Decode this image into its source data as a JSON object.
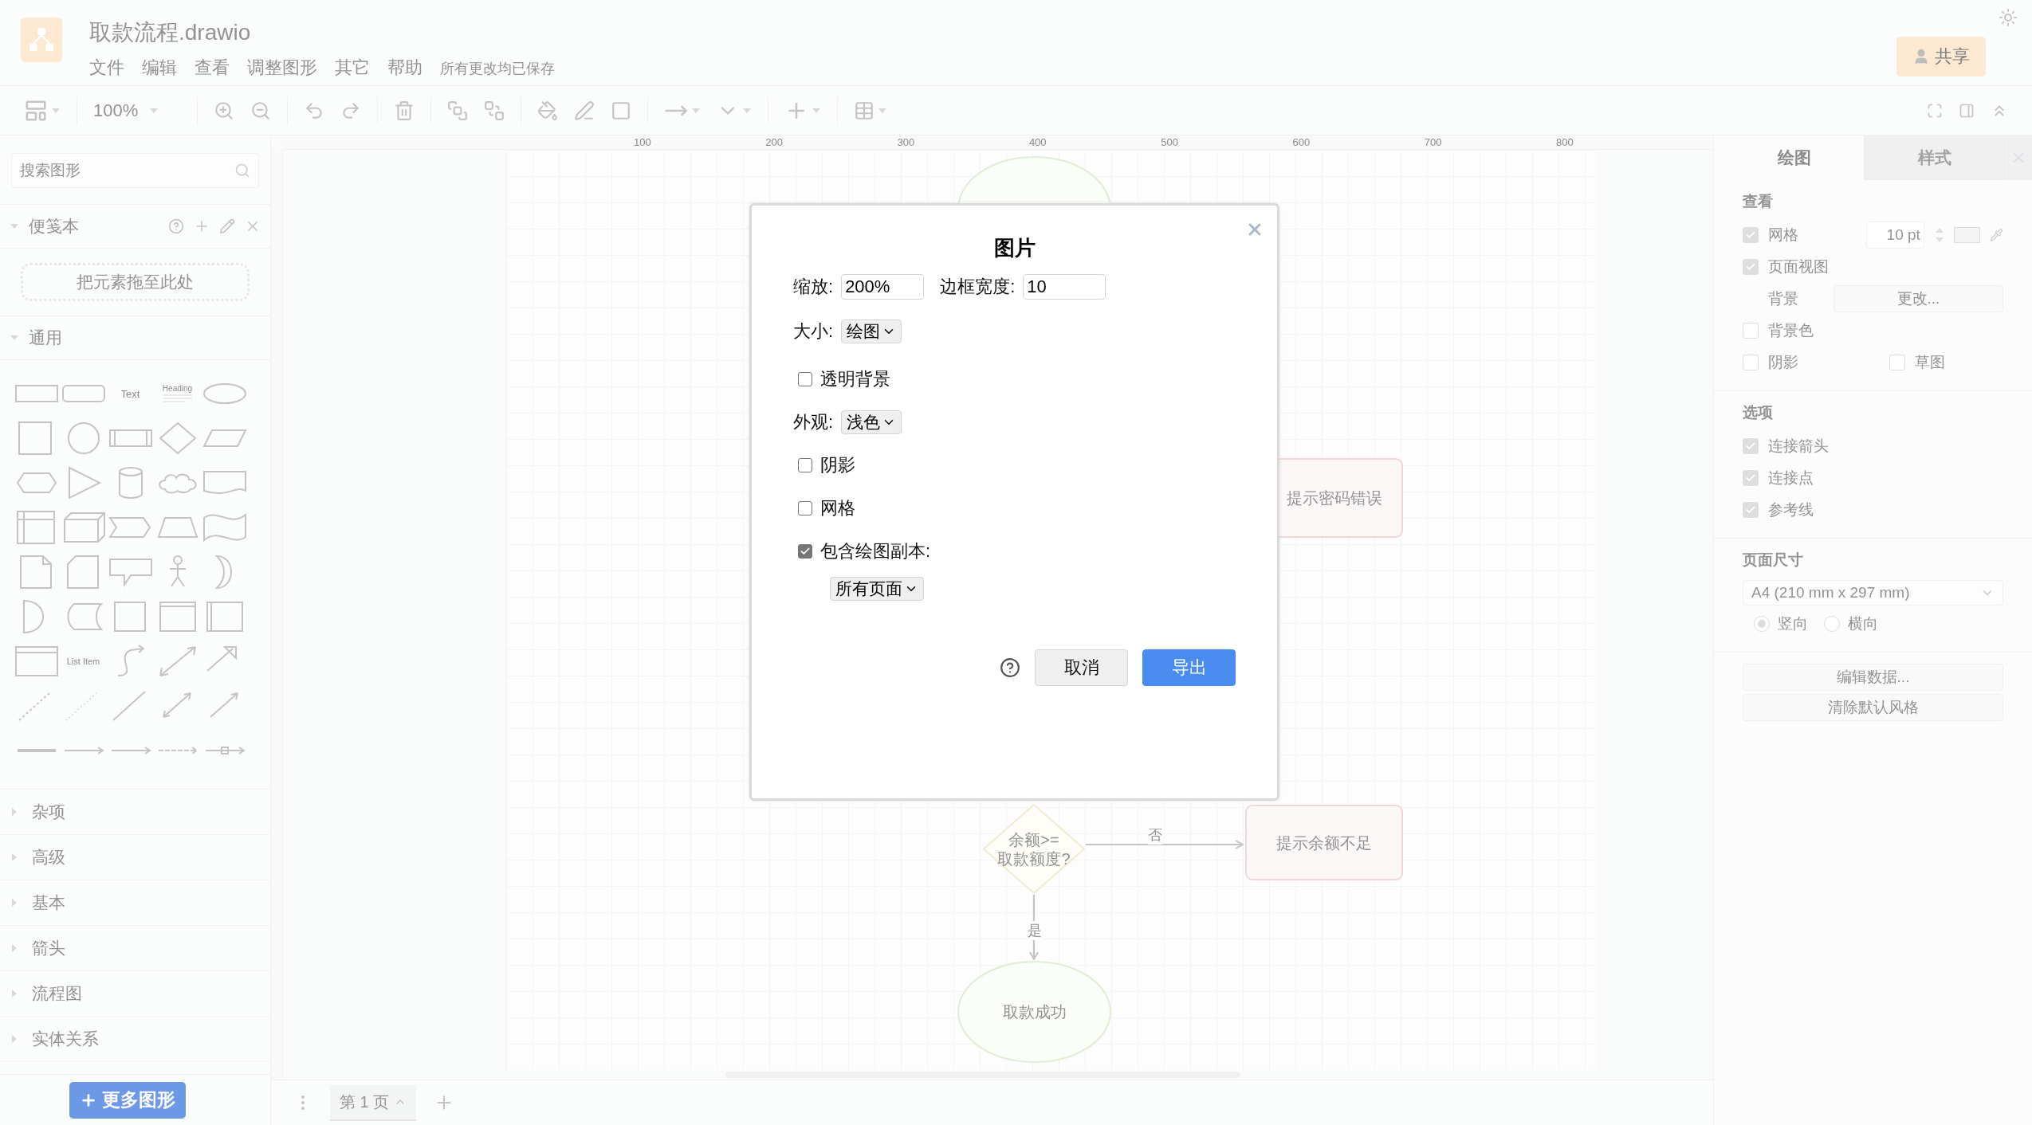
{
  "app": {
    "title": "取款流程.drawio",
    "menus": [
      "文件",
      "编辑",
      "查看",
      "调整图形",
      "其它",
      "帮助"
    ],
    "save_status": "所有更改均已保存",
    "share_button": "共享"
  },
  "toolbar": {
    "zoom": "100%"
  },
  "sidebar": {
    "search_placeholder": "搜索图形",
    "scratchpad": {
      "title": "便笺本",
      "drop_hint": "把元素拖至此处",
      "expanded": true
    },
    "general": {
      "title": "通用",
      "expanded": true,
      "shape_labels": [
        "Text",
        "Heading",
        "List Item"
      ]
    },
    "categories": [
      {
        "label": "杂项",
        "expanded": false
      },
      {
        "label": "高级",
        "expanded": false
      },
      {
        "label": "基本",
        "expanded": false
      },
      {
        "label": "箭头",
        "expanded": false
      },
      {
        "label": "流程图",
        "expanded": false
      },
      {
        "label": "实体关系",
        "expanded": false
      }
    ],
    "more_shapes_button": "更多图形"
  },
  "canvas": {
    "ruler": [
      "100",
      "200",
      "300",
      "400",
      "500",
      "600",
      "700",
      "800"
    ],
    "nodes": [
      {
        "kind": "ellipse"
      },
      {
        "kind": "box",
        "label": "提示密码错误"
      },
      {
        "kind": "diamond",
        "label": "余额>=\n取款额度?"
      },
      {
        "kind": "box",
        "label": "提示余额不足"
      },
      {
        "kind": "ellipse",
        "label": "取款成功"
      }
    ],
    "edges": [
      {
        "kind": "right",
        "label": "否"
      },
      {
        "kind": "down",
        "label": "是"
      }
    ]
  },
  "format_panel": {
    "tabs": [
      {
        "label": "绘图",
        "selected": true
      },
      {
        "label": "样式",
        "selected": false
      }
    ],
    "view": {
      "title": "查看",
      "grid": {
        "label": "网格",
        "checked": true,
        "size": "10 pt"
      },
      "page_view": {
        "label": "页面视图",
        "checked": true
      },
      "background": {
        "label": "背景",
        "button": "更改..."
      },
      "background_color": {
        "label": "背景色",
        "checked": false
      },
      "shadow": {
        "label": "阴影",
        "checked": false
      },
      "sketch": {
        "label": "草图",
        "checked": false
      }
    },
    "options": {
      "title": "选项",
      "items": [
        {
          "label": "连接箭头",
          "checked": true
        },
        {
          "label": "连接点",
          "checked": true
        },
        {
          "label": "参考线",
          "checked": true
        }
      ]
    },
    "page_size": {
      "title": "页面尺寸",
      "value": "A4 (210 mm x 297 mm)",
      "orientations": [
        {
          "label": "竖向",
          "selected": true
        },
        {
          "label": "横向",
          "selected": false
        }
      ]
    },
    "buttons": [
      "编辑数据...",
      "清除默认风格"
    ]
  },
  "page_tabs": [
    {
      "label": "第 1 页",
      "selected": true
    }
  ],
  "dialog": {
    "title": "图片",
    "zoom": {
      "label": "缩放:",
      "value": "200%"
    },
    "border_width": {
      "label": "边框宽度:",
      "value": "10"
    },
    "size": {
      "label": "大小:",
      "value": "绘图"
    },
    "transparent_background": {
      "label": "透明背景",
      "checked": false
    },
    "appearance": {
      "label": "外观:",
      "value": "浅色"
    },
    "shadow": {
      "label": "阴影",
      "checked": false
    },
    "grid": {
      "label": "网格",
      "checked": false
    },
    "include_copy": {
      "label": "包含绘图副本:",
      "checked": true,
      "pages": "所有页面"
    },
    "buttons": [
      {
        "label": "取消",
        "kind": "secondary"
      },
      {
        "label": "导出",
        "kind": "primary"
      }
    ]
  }
}
